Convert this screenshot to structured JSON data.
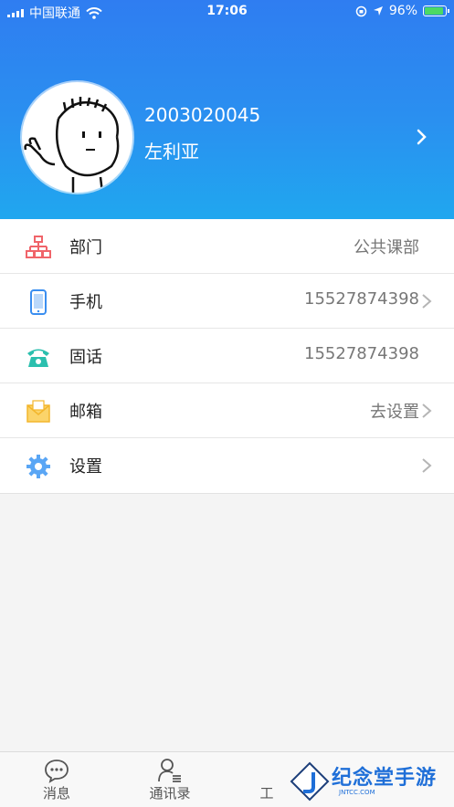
{
  "status_bar": {
    "carrier": "中国联通",
    "time": "17:06",
    "battery_percent": "96%"
  },
  "profile": {
    "id": "2003020045",
    "name": "左利亚"
  },
  "menu": [
    {
      "label": "部门",
      "value": "公共课部",
      "icon": "org-chart-icon",
      "color": "#f0646a"
    },
    {
      "label": "手机",
      "value": "15527874398",
      "icon": "mobile-phone-icon",
      "color": "#3a8ef0"
    },
    {
      "label": "固话",
      "value": "15527874398",
      "icon": "telephone-icon",
      "color": "#2bbfae"
    },
    {
      "label": "邮箱",
      "value": "去设置",
      "icon": "mail-icon",
      "color": "#f3b62c"
    },
    {
      "label": "设置",
      "value": "",
      "icon": "gear-icon",
      "color": "#3a8ef0"
    }
  ],
  "tabbar": {
    "tabs": [
      {
        "label": "消息",
        "icon": "chat-bubble-icon"
      },
      {
        "label": "通讯录",
        "icon": "contacts-icon"
      },
      {
        "label": "工",
        "icon": "work-icon"
      }
    ]
  },
  "watermark": {
    "text": "纪念堂手游",
    "sub": "JNTCC.COM"
  },
  "colors": {
    "header_top": "#2f7df1",
    "header_bottom": "#20a7ef",
    "battery": "#4cd964"
  }
}
